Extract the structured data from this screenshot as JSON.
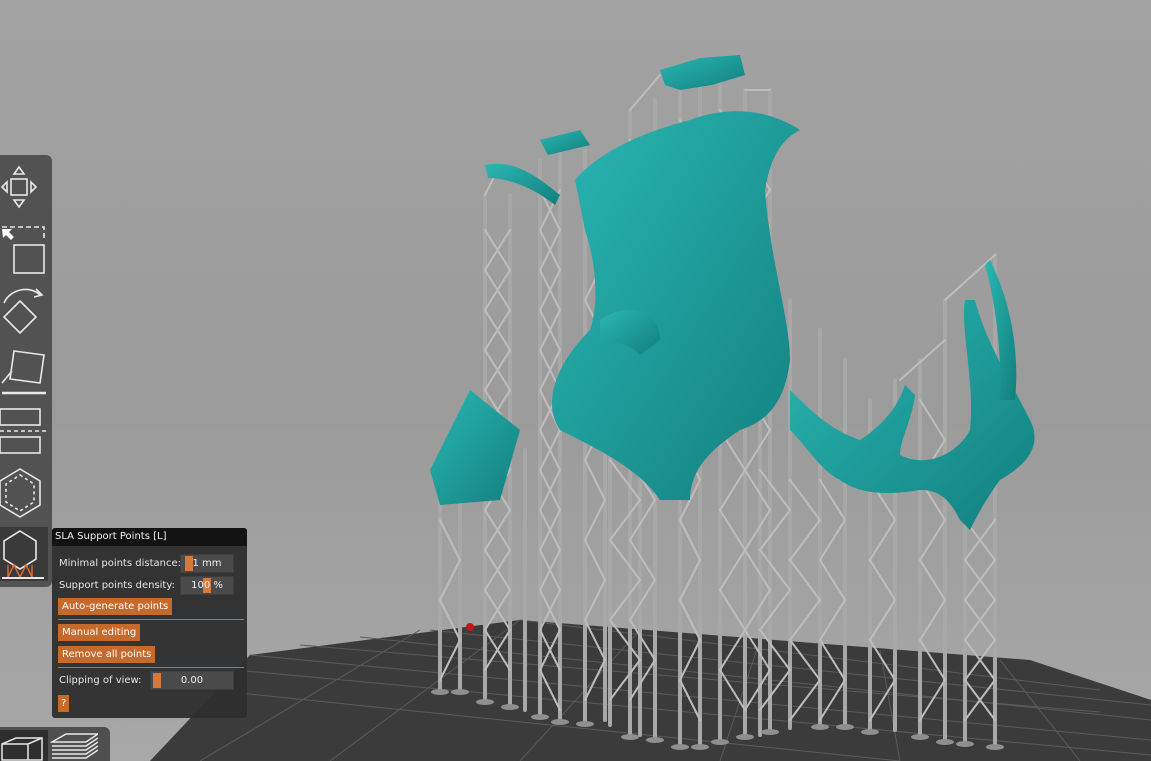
{
  "viewport": {
    "bed_color": "#3a3a3a",
    "support_color": "#b9b9b9",
    "model_color": "#169a99",
    "accent_color": "#c66a2c"
  },
  "toolbar": {
    "items": [
      {
        "name": "move-icon"
      },
      {
        "name": "scale-icon"
      },
      {
        "name": "rotate-icon"
      },
      {
        "name": "place-on-face-icon"
      },
      {
        "name": "cut-icon"
      },
      {
        "name": "hollow-icon"
      },
      {
        "name": "sla-support-points-icon",
        "active": true
      }
    ]
  },
  "viewbar": {
    "items": [
      {
        "name": "3d-view-icon",
        "active": true
      },
      {
        "name": "preview-layers-icon"
      }
    ]
  },
  "panel": {
    "title": "SLA Support Points [L]",
    "min_distance_label": "Minimal points distance:",
    "min_distance_value": "1 mm",
    "density_label": "Support points density:",
    "density_value": "100 %",
    "auto_generate": "Auto-generate points",
    "manual_editing": "Manual editing",
    "remove_all": "Remove all points",
    "clipping_label": "Clipping of view:",
    "clipping_value": "0.00",
    "help": "?"
  }
}
